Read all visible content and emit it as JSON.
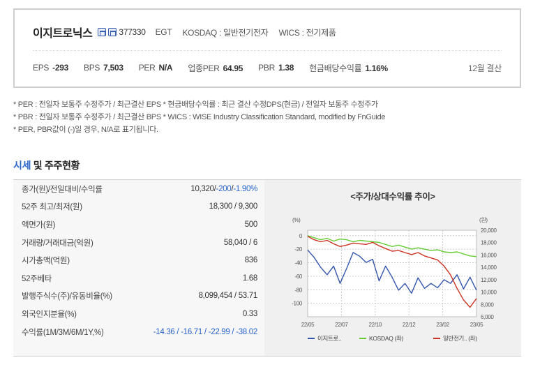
{
  "header": {
    "company_name": "이지트로닉스",
    "code": "377330",
    "code_en": "EGT",
    "market": "KOSDAQ : 일반전기전자",
    "wics": "WICS : 전기제품",
    "metrics": [
      {
        "label": "EPS",
        "value": "-293"
      },
      {
        "label": "BPS",
        "value": "7,503"
      },
      {
        "label": "PER",
        "value": "N/A"
      },
      {
        "label": "업종PER",
        "value": "64.95"
      },
      {
        "label": "PBR",
        "value": "1.38"
      },
      {
        "label": "현금배당수익률",
        "value": "1.16%"
      }
    ],
    "settlement": "12월 결산"
  },
  "notes": [
    "* PER : 전일자 보통주 수정주가 / 최근결산 EPS * 현금배당수익률 : 최근 결산 수정DPS(현금) / 전일자 보통주 수정주가",
    "* PBR : 전일자 보통주 수정주가 / 최근결산 BPS * WICS : WISE Industry Classification Standard, modified by FnGuide",
    "* PER, PBR값이 (-)일 경우, N/A로 표기됩니다."
  ],
  "section": {
    "title_highlight": "시세",
    "title_rest": " 및 주주현황"
  },
  "table": {
    "rows": [
      {
        "label": "종가(원)/전일대비/수익률",
        "value_parts": [
          "10,320",
          "/",
          "-200",
          "/",
          "-1.90%"
        ]
      },
      {
        "label": "52주 최고/최저(원)",
        "value": "18,300 / 9,300"
      },
      {
        "label": "액면가(원)",
        "value": "500"
      },
      {
        "label": "거래량/거래대금(억원)",
        "value": "58,040 / 6"
      },
      {
        "label": "시가총액(억원)",
        "value": "836"
      },
      {
        "label": "52주베타",
        "value": "1.68"
      },
      {
        "label": "발행주식수(주)/유동비율(%)",
        "value": "8,099,454 / 53.71"
      },
      {
        "label": "외국인지분율(%)",
        "value": "0.33"
      },
      {
        "label": "수익률(1M/3M/6M/1Y,%)",
        "value": "-14.36 / -16.71 / -22.99 / -38.02"
      }
    ]
  },
  "chart_data": {
    "type": "line",
    "title": "<주가/상대수익률 추이>",
    "left_unit": "(%)",
    "right_unit": "(원)",
    "x_ticks": [
      "22/05",
      "22/07",
      "22/10",
      "22/12",
      "23/02",
      "23/05"
    ],
    "left_axis": {
      "ticks": [
        0,
        -20,
        -40,
        -60,
        -80,
        -100
      ],
      "ylim": [
        -120,
        8
      ]
    },
    "right_axis": {
      "ticks": [
        "20,000",
        "18,000",
        "16,000",
        "14,000",
        "12,000",
        "10,000",
        "8,000",
        "6,000"
      ],
      "ylim": [
        6000,
        20000
      ]
    },
    "grid": true,
    "legend_position": "bottom",
    "series": [
      {
        "name": "이지트로..",
        "axis": "right",
        "color": "#3355aa",
        "values": [
          16800,
          15600,
          14000,
          12800,
          14200,
          11400,
          13800,
          16400,
          15800,
          14800,
          15300,
          11800,
          14200,
          12400,
          10300,
          11400,
          9800,
          12300,
          10600,
          11400,
          10700,
          12000,
          11400,
          12800,
          10500,
          12400,
          10300
        ]
      },
      {
        "name": "KOSDAQ (좌)",
        "axis": "left",
        "color": "#66cc33",
        "values": [
          0,
          -3,
          -6,
          -4,
          -8,
          -5,
          -6,
          -9,
          -7,
          -8,
          -9,
          -10,
          -13,
          -16,
          -14,
          -17,
          -20,
          -18,
          -20,
          -22,
          -21,
          -24,
          -25,
          -24,
          -27,
          -30,
          -31
        ]
      },
      {
        "name": "일반전기.. (좌)",
        "axis": "left",
        "color": "#cc3322",
        "values": [
          -1,
          -6,
          -9,
          -7,
          -12,
          -16,
          -14,
          -11,
          -12,
          -13,
          -10,
          -15,
          -19,
          -23,
          -22,
          -25,
          -28,
          -25,
          -30,
          -33,
          -36,
          -45,
          -58,
          -78,
          -95,
          -106,
          -93
        ]
      }
    ]
  }
}
